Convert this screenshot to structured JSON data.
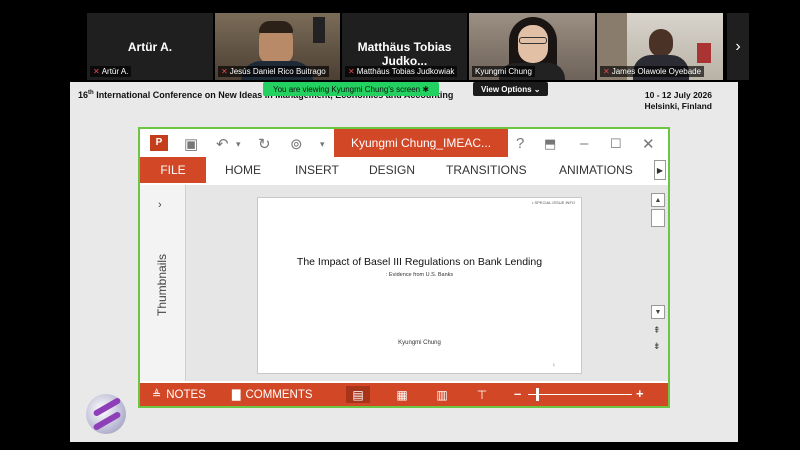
{
  "participants": [
    {
      "display": "Artür A.",
      "label": "Artür A."
    },
    {
      "label": "Jesús Daniel Rico Buitrago"
    },
    {
      "display": "Matthäus Tobias Judko...",
      "label": "Matthäus Tobias Judkowiak"
    },
    {
      "label": "Kyungmi Chung"
    },
    {
      "label": "James Olawole Oyebade"
    }
  ],
  "banner": {
    "text": "You are viewing  Kyungmi Chung's screen  ✱",
    "view_options": "View Options ⌄"
  },
  "conference": {
    "edition": "16",
    "edition_suffix": "th",
    "title": " International Conference on New Ideas in Management, Economics and Accounting",
    "dates": "10 - 12 July 2026",
    "location": "Helsinki, Finland"
  },
  "ppt": {
    "doc_title": "Kyungmi Chung_IMEAC...",
    "tabs": [
      "FILE",
      "HOME",
      "INSERT",
      "DESIGN",
      "TRANSITIONS",
      "ANIMATIONS"
    ],
    "thumbnails_label": "Thumbnails",
    "slide": {
      "corner_text": "• SPECIAL ISSUE INFO",
      "title": "The Impact of Basel III Regulations on Bank Lending",
      "subtitle": ": Evidence from U.S. Banks",
      "author": "Kyungmi Chung",
      "page": "1"
    },
    "status": {
      "notes": "NOTES",
      "comments": "COMMENTS"
    }
  },
  "colors": {
    "ppt_accent": "#d24726",
    "active_green": "#6cc644",
    "banner_green": "#23d160"
  }
}
